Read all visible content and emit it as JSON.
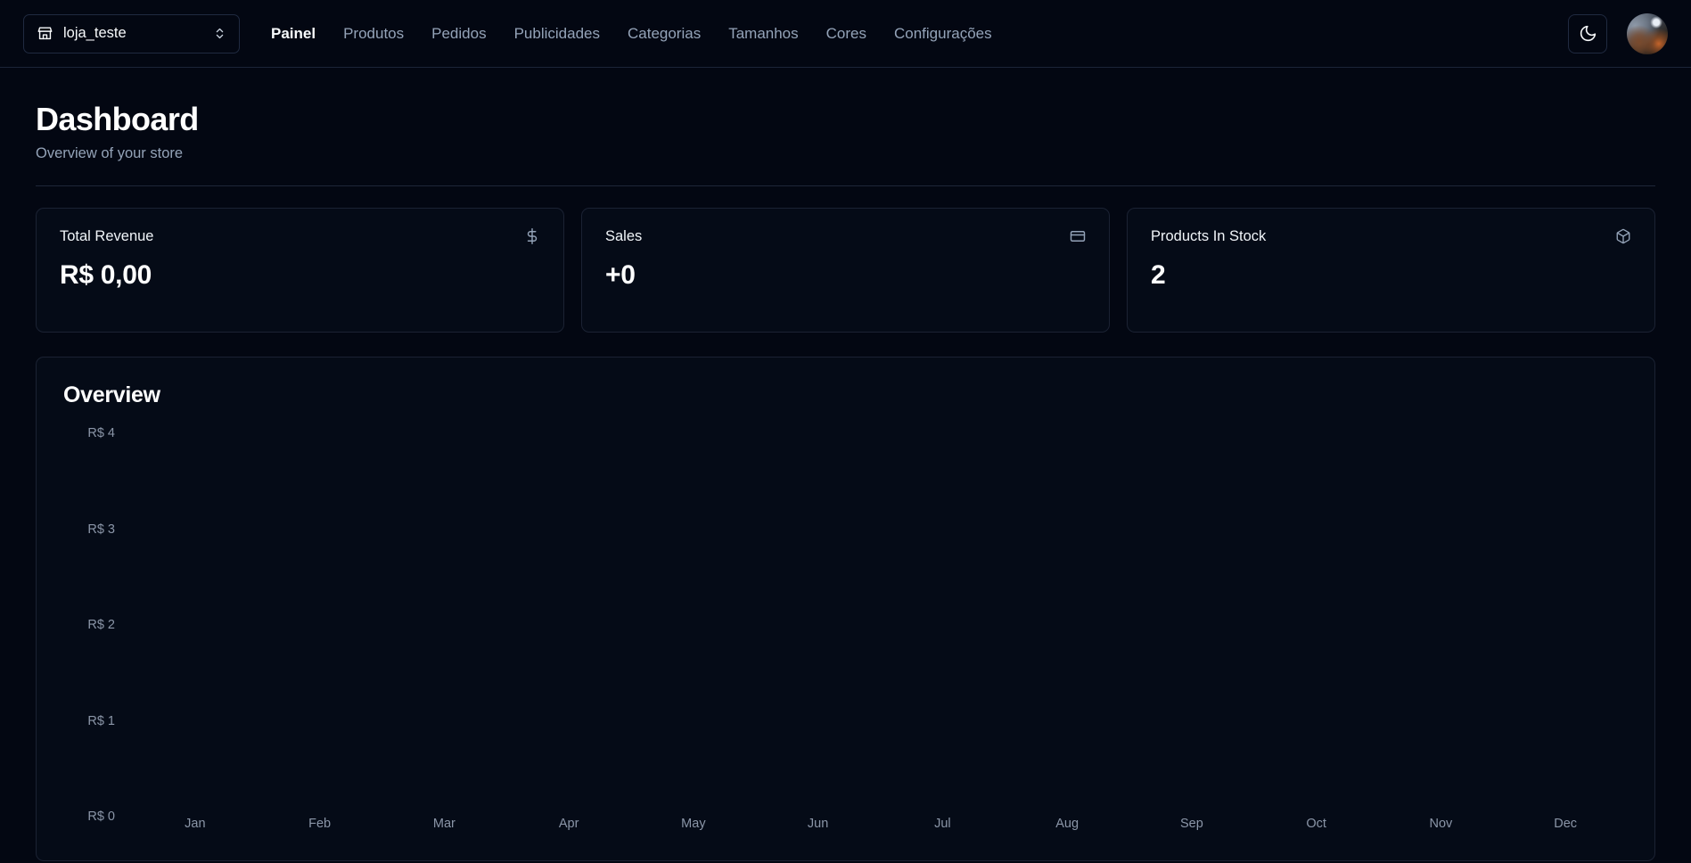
{
  "header": {
    "store_switcher": {
      "icon": "storefront-icon",
      "label": "loja_teste",
      "chevron_icon": "chevrons-up-down-icon"
    },
    "nav": [
      {
        "label": "Painel",
        "active": true
      },
      {
        "label": "Produtos",
        "active": false
      },
      {
        "label": "Pedidos",
        "active": false
      },
      {
        "label": "Publicidades",
        "active": false
      },
      {
        "label": "Categorias",
        "active": false
      },
      {
        "label": "Tamanhos",
        "active": false
      },
      {
        "label": "Cores",
        "active": false
      },
      {
        "label": "Configurações",
        "active": false
      }
    ],
    "theme_toggle_icon": "moon-icon",
    "avatar": "user-avatar"
  },
  "page": {
    "title": "Dashboard",
    "subtitle": "Overview of your store"
  },
  "stats": [
    {
      "label": "Total Revenue",
      "value": "R$ 0,00",
      "icon": "dollar-sign-icon"
    },
    {
      "label": "Sales",
      "value": "+0",
      "icon": "credit-card-icon"
    },
    {
      "label": "Products In Stock",
      "value": "2",
      "icon": "package-icon"
    }
  ],
  "overview": {
    "title": "Overview"
  },
  "chart_data": {
    "type": "bar",
    "title": "Overview",
    "categories": [
      "Jan",
      "Feb",
      "Mar",
      "Apr",
      "May",
      "Jun",
      "Jul",
      "Aug",
      "Sep",
      "Oct",
      "Nov",
      "Dec"
    ],
    "values": [
      0,
      0,
      0,
      0,
      0,
      0,
      0,
      0,
      0,
      0,
      0,
      0
    ],
    "ytick_labels": [
      "R$ 4",
      "R$ 3",
      "R$ 2",
      "R$ 1",
      "R$ 0"
    ],
    "ytick_values": [
      4,
      3,
      2,
      1,
      0
    ],
    "ylim": [
      0,
      4
    ],
    "xlabel": "",
    "ylabel": "",
    "grid": false,
    "legend": false,
    "bar_color": "#f8fafc"
  },
  "colors": {
    "page_background": "#030712",
    "card_background": "#050b17",
    "card_border": "#1b2233",
    "text_primary": "#ffffff",
    "text_muted": "#94a3b8",
    "axis_text": "#8b96a8"
  }
}
